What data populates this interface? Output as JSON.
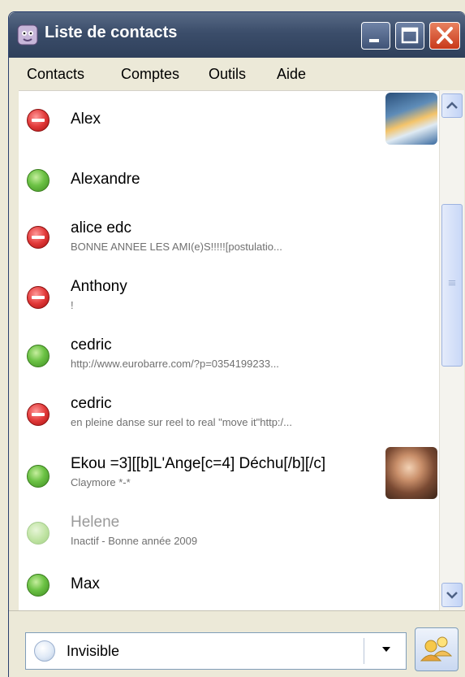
{
  "window": {
    "title": "Liste de contacts"
  },
  "menu": {
    "items": [
      "Contacts",
      "Comptes",
      "Outils",
      "Aide"
    ]
  },
  "contacts": [
    {
      "name": "Alex",
      "message": "",
      "status": "busy",
      "avatar": "space-shuttle"
    },
    {
      "name": "Alexandre",
      "message": "",
      "status": "online",
      "avatar": ""
    },
    {
      "name": "alice edc",
      "message": "BONNE ANNEE LES AMI(e)S!!!!![postulatio...",
      "status": "busy",
      "avatar": ""
    },
    {
      "name": "Anthony",
      "message": "!",
      "status": "busy",
      "avatar": ""
    },
    {
      "name": "cedric",
      "message": "http://www.eurobarre.com/?p=0354199233...",
      "status": "online",
      "avatar": ""
    },
    {
      "name": "cedric",
      "message": "en pleine danse sur reel to real \"move it\"http:/...",
      "status": "busy",
      "avatar": ""
    },
    {
      "name": "Ekou =3][[b]L'Ange[c=4] Déchu[/b][/c]",
      "message": "Claymore *-*",
      "status": "online",
      "avatar": "angel"
    },
    {
      "name": "Helene",
      "message": "Inactif - Bonne année 2009",
      "status": "idle",
      "avatar": ""
    },
    {
      "name": "Max",
      "message": "",
      "status": "online",
      "avatar": ""
    }
  ],
  "status_selector": {
    "label": "Invisible"
  },
  "colors": {
    "titlebar": "#3b4d6a",
    "online": "#6cc245",
    "busy": "#e23a3a",
    "idle": "#bfe3a2"
  }
}
